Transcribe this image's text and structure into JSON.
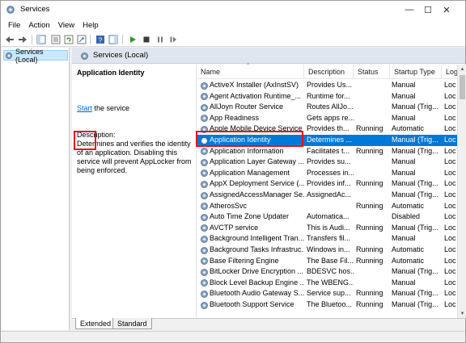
{
  "window": {
    "title": "Services",
    "minimize_glyph": "—",
    "maximize_glyph": "☐",
    "close_glyph": "✕"
  },
  "menu": {
    "items": [
      "File",
      "Action",
      "View",
      "Help"
    ]
  },
  "toolbar": {
    "icons": [
      "back-arrow-icon",
      "forward-arrow-icon",
      "console-tree-icon",
      "properties-icon",
      "refresh-icon",
      "export-list-icon",
      "help-icon",
      "show-hide-icon",
      "start-icon",
      "stop-icon",
      "pause-icon",
      "restart-icon"
    ]
  },
  "tree": {
    "item": "Services (Local)"
  },
  "pane": {
    "header": "Services (Local)"
  },
  "description": {
    "title": "Application Identity",
    "start_link": "Start",
    "start_suffix": " the service",
    "label": "Description:",
    "body": "Determines and verifies the identity of an application. Disabling this service will prevent AppLocker from being enforced."
  },
  "columns": [
    "Name",
    "Description",
    "Status",
    "Startup Type",
    "Log"
  ],
  "services": [
    {
      "name": "ActiveX Installer (AxInstSV)",
      "desc": "Provides Us...",
      "status": "",
      "startup": "Manual",
      "log": "Loc"
    },
    {
      "name": "Agent Activation Runtime_...",
      "desc": "Runtime for...",
      "status": "",
      "startup": "Manual",
      "log": "Loc"
    },
    {
      "name": "AllJoyn Router Service",
      "desc": "Routes AllJo...",
      "status": "",
      "startup": "Manual (Trig...",
      "log": "Loc"
    },
    {
      "name": "App Readiness",
      "desc": "Gets apps re...",
      "status": "",
      "startup": "Manual",
      "log": "Loc"
    },
    {
      "name": "Apple Mobile Device Service",
      "desc": "Provides th...",
      "status": "Running",
      "startup": "Automatic",
      "log": "Loc"
    },
    {
      "name": "Application Identity",
      "desc": "Determines ...",
      "status": "",
      "startup": "Manual (Trig...",
      "log": "Loc",
      "selected": true
    },
    {
      "name": "Application Information",
      "desc": "Facilitates t...",
      "status": "Running",
      "startup": "Manual (Trig...",
      "log": "Loc"
    },
    {
      "name": "Application Layer Gateway ...",
      "desc": "Provides su...",
      "status": "",
      "startup": "Manual",
      "log": "Loc"
    },
    {
      "name": "Application Management",
      "desc": "Processes in...",
      "status": "",
      "startup": "Manual",
      "log": "Loc"
    },
    {
      "name": "AppX Deployment Service (...",
      "desc": "Provides inf...",
      "status": "Running",
      "startup": "Manual (Trig...",
      "log": "Loc"
    },
    {
      "name": "AssignedAccessManager Se...",
      "desc": "AssignedAc...",
      "status": "",
      "startup": "Manual (Trig...",
      "log": "Loc"
    },
    {
      "name": "AtherosSvc",
      "desc": "",
      "status": "Running",
      "startup": "Automatic",
      "log": "Loc"
    },
    {
      "name": "Auto Time Zone Updater",
      "desc": "Automatica...",
      "status": "",
      "startup": "Disabled",
      "log": "Loc"
    },
    {
      "name": "AVCTP service",
      "desc": "This is Audi...",
      "status": "Running",
      "startup": "Manual (Trig...",
      "log": "Loc"
    },
    {
      "name": "Background Intelligent Tran...",
      "desc": "Transfers fil...",
      "status": "",
      "startup": "Manual",
      "log": "Loc"
    },
    {
      "name": "Background Tasks Infrastruc...",
      "desc": "Windows in...",
      "status": "Running",
      "startup": "Automatic",
      "log": "Loc"
    },
    {
      "name": "Base Filtering Engine",
      "desc": "The Base Fil...",
      "status": "Running",
      "startup": "Automatic",
      "log": "Loc"
    },
    {
      "name": "BitLocker Drive Encryption ...",
      "desc": "BDESVC hos...",
      "status": "",
      "startup": "Manual (Trig...",
      "log": "Loc"
    },
    {
      "name": "Block Level Backup Engine ...",
      "desc": "The WBENG...",
      "status": "",
      "startup": "Manual",
      "log": "Loc"
    },
    {
      "name": "Bluetooth Audio Gateway S...",
      "desc": "Service sup...",
      "status": "Running",
      "startup": "Manual (Trig...",
      "log": "Loc"
    },
    {
      "name": "Bluetooth Support Service",
      "desc": "The Bluetoo...",
      "status": "Running",
      "startup": "Manual (Trig...",
      "log": "Loc"
    }
  ],
  "tabs": [
    "Extended",
    "Standard"
  ],
  "colors": {
    "selection": "#0078d7",
    "highlight_box": "#e0141e",
    "link": "#0066cc",
    "pane_header": "#dfe6ef"
  }
}
